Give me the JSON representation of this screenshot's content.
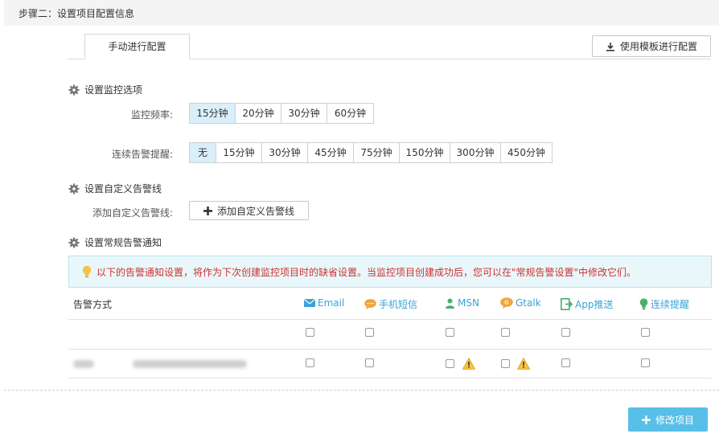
{
  "step_header": {
    "title": "步骤二：设置项目配置信息"
  },
  "tabs": {
    "manual_label": "手动进行配置"
  },
  "template_button": {
    "label": "使用模板进行配置",
    "icon": "download-icon"
  },
  "monitor_section": {
    "title": "设置监控选项",
    "frequency_label": "监控频率:",
    "frequency_options": [
      "15分钟",
      "20分钟",
      "30分钟",
      "60分钟"
    ],
    "frequency_selected": "15分钟",
    "repeat_label": "连续告警提醒:",
    "repeat_options": [
      "无",
      "15分钟",
      "30分钟",
      "45分钟",
      "75分钟",
      "150分钟",
      "300分钟",
      "450分钟"
    ],
    "repeat_selected": "无"
  },
  "custom_section": {
    "title": "设置自定义告警线",
    "add_label": "添加自定义告警线:",
    "add_button": "添加自定义告警线"
  },
  "notify_section": {
    "title": "设置常规告警通知",
    "notice": "以下的告警通知设置，将作为下次创建监控项目时的缺省设置。当监控项目创建成功后，您可以在\"常规告警设置\"中修改它们。",
    "method_header": "告警方式",
    "columns": [
      {
        "label": "Email",
        "icon": "email-icon"
      },
      {
        "label": "手机短信",
        "icon": "sms-icon"
      },
      {
        "label": "MSN",
        "icon": "msn-icon"
      },
      {
        "label": "Gtalk",
        "icon": "gtalk-icon"
      },
      {
        "label": "App推送",
        "icon": "app-push-icon"
      },
      {
        "label": "连续提醒",
        "icon": "bulb-icon"
      }
    ]
  },
  "colors": {
    "accent": "#3aa2d6",
    "selected": "#d9effa",
    "warning_text": "#d0312d",
    "save_button": "#58bfe8"
  },
  "save_button": {
    "label": "修改项目"
  }
}
